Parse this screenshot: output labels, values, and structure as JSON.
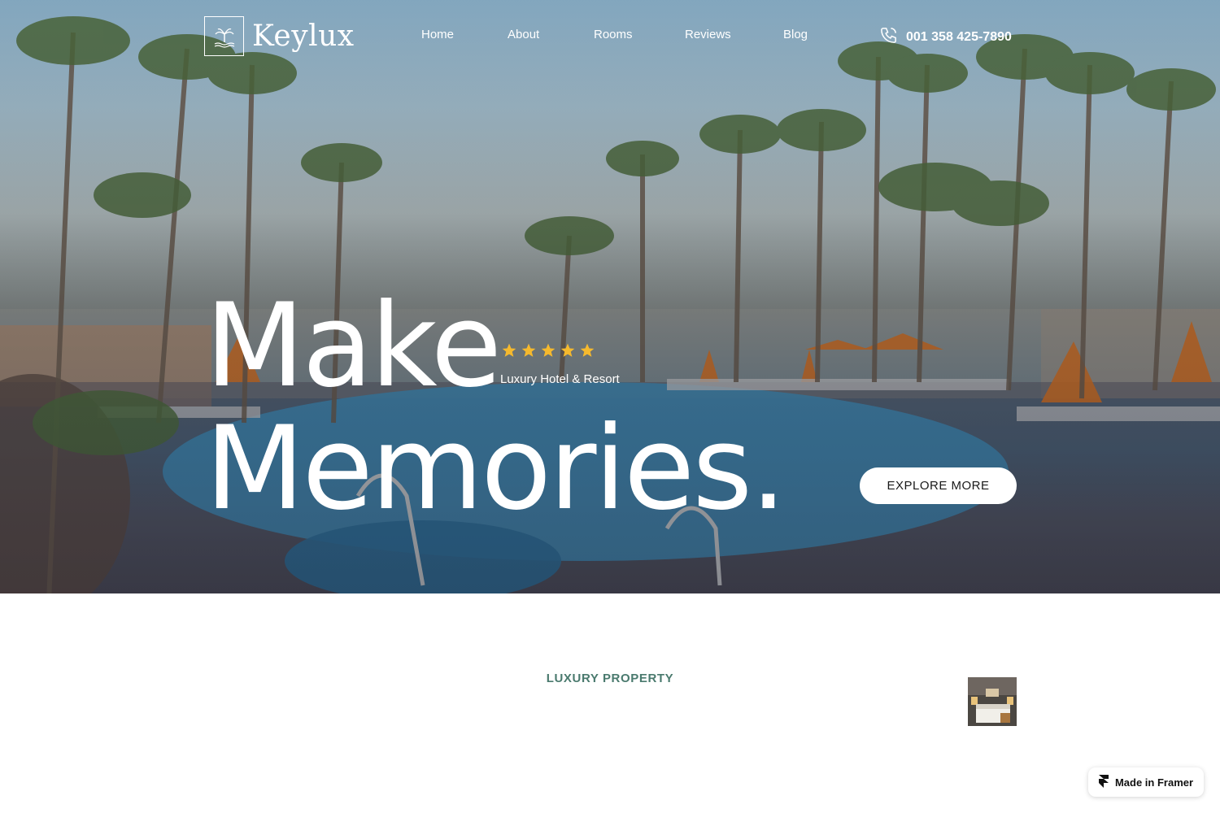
{
  "brand": {
    "name": "Keylux"
  },
  "nav": {
    "items": [
      {
        "label": "Home"
      },
      {
        "label": "About"
      },
      {
        "label": "Rooms"
      },
      {
        "label": "Reviews"
      },
      {
        "label": "Blog"
      }
    ],
    "phone": "001 358 425-7890"
  },
  "hero": {
    "headline_line1": "Make",
    "headline_line2": "Memories.",
    "rating": 5,
    "rating_max": 5,
    "tagline": "Luxury Hotel & Resort",
    "cta_label": "EXPLORE MORE"
  },
  "section": {
    "label": "LUXURY PROPERTY"
  },
  "badge": {
    "label": "Made in Framer"
  },
  "colors": {
    "star": "#f5b92e",
    "accent": "#4a7a6e",
    "umbrella": "#d8701f"
  },
  "icons": [
    "palm-logo-icon",
    "phone-icon",
    "star-icon",
    "framer-icon"
  ]
}
